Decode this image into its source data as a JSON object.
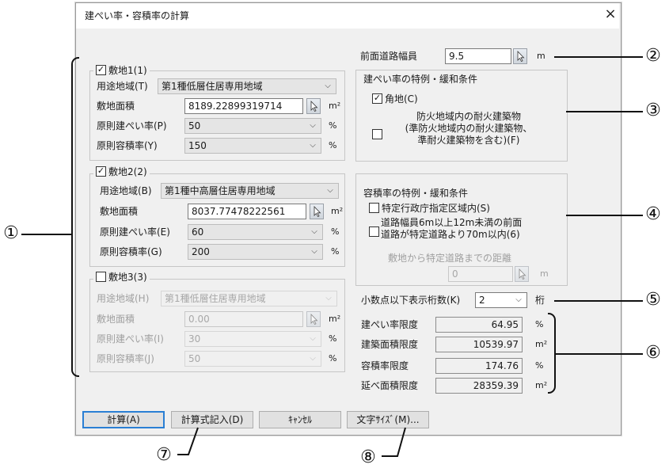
{
  "dialog": {
    "title": "建ぺい率・容積率の計算",
    "close_label": "×"
  },
  "site1": {
    "legend": "敷地1(1)",
    "use_district_label": "用途地域(T)",
    "use_district_value": "第1種低層住居専用地域",
    "area_label": "敷地面積",
    "area_value": "8189.22899319714",
    "area_unit": "m²",
    "bcr_label": "原則建ぺい率(P)",
    "bcr_value": "50",
    "far_label": "原則容積率(Y)",
    "far_value": "150",
    "percent": "%"
  },
  "site2": {
    "legend": "敷地2(2)",
    "use_district_label": "用途地域(B)",
    "use_district_value": "第1種中高層住居専用地域",
    "area_label": "敷地面積",
    "area_value": "8037.77478222561",
    "area_unit": "m²",
    "bcr_label": "原則建ぺい率(E)",
    "bcr_value": "60",
    "far_label": "原則容積率(G)",
    "far_value": "200",
    "percent": "%"
  },
  "site3": {
    "legend": "敷地3(3)",
    "use_district_label": "用途地域(H)",
    "use_district_value": "第1種低層住居専用地域",
    "area_label": "敷地面積",
    "area_value": "0.00",
    "area_unit": "m²",
    "bcr_label": "原則建ぺい率(I)",
    "bcr_value": "30",
    "far_label": "原則容積率(J)",
    "far_value": "50",
    "percent": "%"
  },
  "road": {
    "label": "前面道路幅員",
    "value": "9.5",
    "unit": "m"
  },
  "bcr_special": {
    "title": "建ぺい率の特例・緩和条件",
    "corner_label": "角地(C)",
    "fireproof_line1": "防火地域内の耐火建築物",
    "fireproof_line2": "(準防火地域内の耐火建築物、",
    "fireproof_line3": "準耐火建築物を含む)(F)"
  },
  "far_special": {
    "title": "容積率の特例・緩和条件",
    "designated_city_label": "特定行政庁指定区域内(S)",
    "road_line1": "道路幅員6m以上12m未満の前面",
    "road_line2": "道路が特定道路より70m以内(6)",
    "distance_label": "敷地から特定道路までの距離",
    "distance_value": "0",
    "distance_unit": "m"
  },
  "decimals": {
    "label": "小数点以下表示桁数(K)",
    "value": "2",
    "unit": "桁"
  },
  "results": {
    "bcr_limit_label": "建ぺい率限度",
    "bcr_limit_value": "64.95",
    "bcr_limit_unit": "%",
    "building_area_label": "建築面積限度",
    "building_area_value": "10539.97",
    "building_area_unit": "m²",
    "far_limit_label": "容積率限度",
    "far_limit_value": "174.76",
    "far_limit_unit": "%",
    "floor_area_label": "延べ面積限度",
    "floor_area_value": "28359.39",
    "floor_area_unit": "m²"
  },
  "buttons": {
    "calc": "計算(A)",
    "formula": "計算式記入(D)",
    "cancel": "ｷｬﾝｾﾙ",
    "font_size": "文字ｻｲｽﾞ(M)..."
  },
  "callouts": [
    "①",
    "②",
    "③",
    "④",
    "⑤",
    "⑥",
    "⑦",
    "⑧"
  ],
  "icons": {
    "picker": "cursor-arrow-icon",
    "dropdown": "chevron-down-icon",
    "close": "close-icon"
  }
}
